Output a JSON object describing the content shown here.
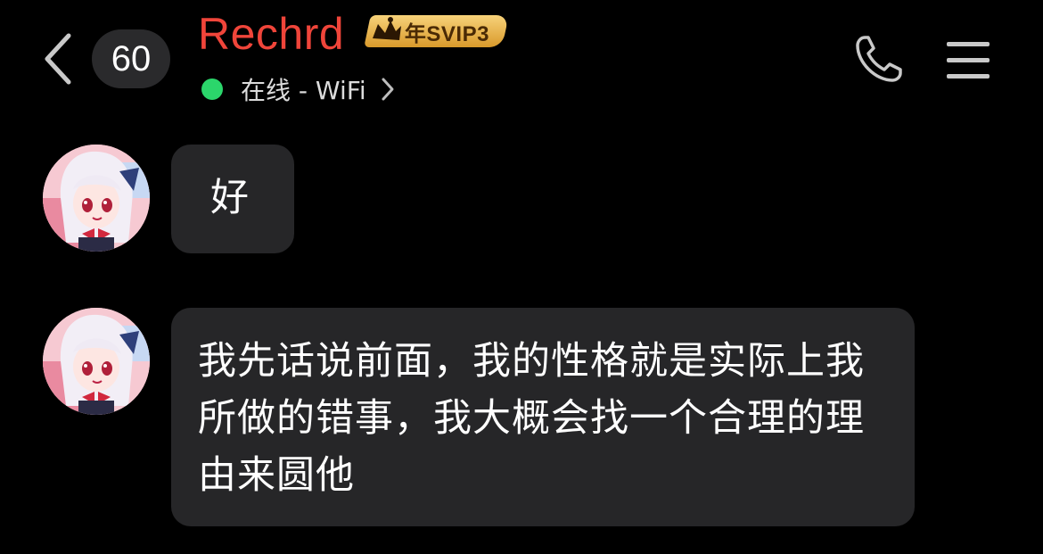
{
  "header": {
    "back_icon": "chevron-left-icon",
    "unread_count": "60",
    "contact_name": "Rechrd",
    "vip_badge_text": "年SVIP3",
    "status_text": "在线 - WiFi",
    "status_chevron_icon": "chevron-right-icon",
    "call_icon": "phone-icon",
    "menu_icon": "hamburger-menu-icon"
  },
  "colors": {
    "background": "#000000",
    "contact_name": "#f0453a",
    "online_dot": "#2bd66b",
    "bubble": "#262628",
    "badge_bg": "#2a2a2c",
    "vip_gold": "#e8b54a"
  },
  "messages": [
    {
      "sender": "contact",
      "avatar_icon": "anime-girl-avatar",
      "text": "好"
    },
    {
      "sender": "contact",
      "avatar_icon": "anime-girl-avatar",
      "text": "我先话说前面，我的性格就是实际上我所做的错事，我大概会找一个合理的理由来圆他"
    }
  ]
}
